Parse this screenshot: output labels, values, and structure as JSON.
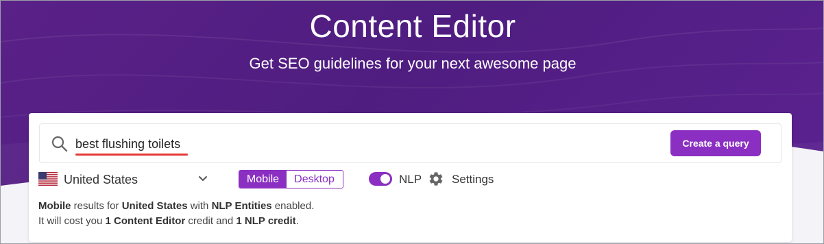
{
  "header": {
    "title": "Content Editor",
    "subtitle": "Get SEO guidelines for your next awesome page"
  },
  "search": {
    "icon": "search-icon",
    "value": "best flushing toilets",
    "button_label": "Create a query"
  },
  "controls": {
    "country_flag": "us-flag-icon",
    "country": "United States",
    "device_options": [
      "Mobile",
      "Desktop"
    ],
    "device_selected": "Mobile",
    "nlp_toggle_on": true,
    "nlp_label": "NLP",
    "settings_label": "Settings"
  },
  "info": {
    "line1": {
      "device": "Mobile",
      "t1": " results for ",
      "country": "United States",
      "t2": " with ",
      "entities": "NLP Entities",
      "t3": " enabled."
    },
    "line2": {
      "t1": "It will cost you ",
      "credit1": "1 Content Editor",
      "t2": " credit and ",
      "credit2": "1 NLP credit",
      "t3": "."
    }
  },
  "colors": {
    "hero": "#4f1d80",
    "accent": "#8a2fc1",
    "underline": "#e53935"
  }
}
